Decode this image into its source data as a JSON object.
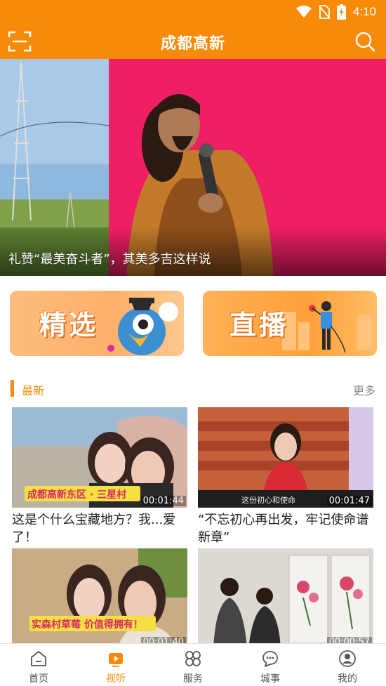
{
  "status_bar": {
    "time": "4:10",
    "icons": [
      "wifi-icon",
      "no-sim-icon",
      "battery-charging-icon"
    ]
  },
  "header": {
    "title": "成都高新",
    "left_icon": "scan-icon",
    "right_icon": "search-icon"
  },
  "banner": {
    "caption": "礼赞“最美奋斗者”，其美多吉这样说"
  },
  "feature_cards": [
    {
      "label": "精选"
    },
    {
      "label": "直播"
    }
  ],
  "section": {
    "title": "最新",
    "more_label": "更多"
  },
  "videos": [
    {
      "title": "这是个什么宝藏地方？我...爱了！",
      "duration": "00:01:44",
      "overlay_text": "成都高新东区 · 三星村"
    },
    {
      "title": "“不忘初心再出发，牢记使命谱新章”",
      "duration": "00:01:47",
      "overlay_text": "这份初心和使命"
    },
    {
      "title": "",
      "duration": "00:01:40",
      "overlay_text": "实森村草莓 价值得拥有！"
    },
    {
      "title": "",
      "duration": "00:00:57",
      "overlay_text": ""
    }
  ],
  "bottom_nav": [
    {
      "label": "首页",
      "icon": "home-icon",
      "active": false
    },
    {
      "label": "视听",
      "icon": "video-play-icon",
      "active": true
    },
    {
      "label": "服务",
      "icon": "services-grid-icon",
      "active": false
    },
    {
      "label": "城事",
      "icon": "chat-bubble-icon",
      "active": false
    },
    {
      "label": "我的",
      "icon": "profile-icon",
      "active": false
    }
  ],
  "colors": {
    "brand_orange": "#f98a08",
    "text_dark": "#222222",
    "text_muted": "#888888"
  }
}
